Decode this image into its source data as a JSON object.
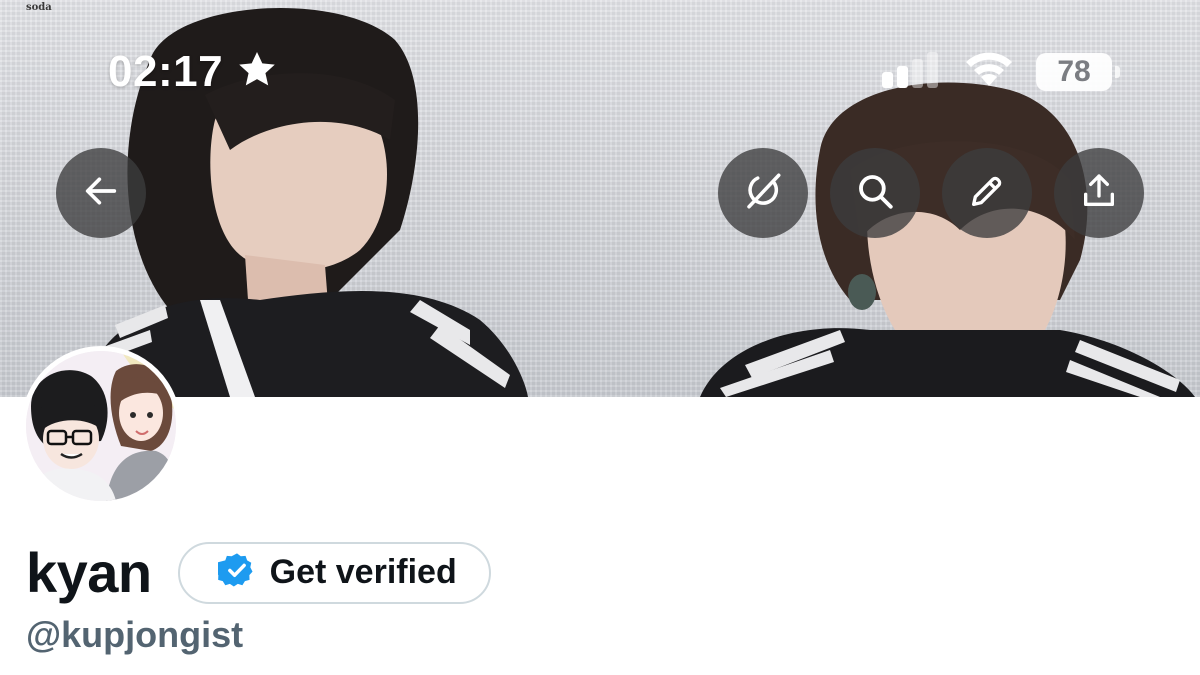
{
  "banner": {
    "watermark": "soda"
  },
  "status_bar": {
    "time": "02:17",
    "battery_percent": "78",
    "icons": [
      "star-icon",
      "cellular-signal-icon",
      "wifi-icon",
      "battery-icon"
    ]
  },
  "header_buttons": {
    "back": "back-arrow-icon",
    "grok": "grok-icon",
    "search": "search-icon",
    "edit": "edit-pencil-icon",
    "share": "share-icon"
  },
  "profile": {
    "display_name": "kyan",
    "verify_button_label": "Get verified",
    "handle": "@kupjongist",
    "verified_badge_color": "#1d9bf0"
  },
  "colors": {
    "name_text": "#0f1419",
    "handle_text": "#536471",
    "button_border": "#cfd9de",
    "overlay_button": "#3c3c3e"
  }
}
